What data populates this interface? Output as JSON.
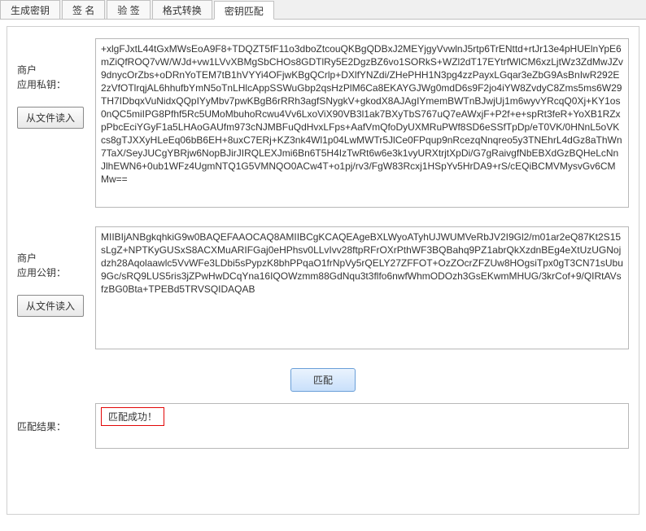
{
  "tabs": {
    "gen_key": "生成密钥",
    "sign": "签  名",
    "verify": "验  签",
    "format": "格式转换",
    "match": "密钥匹配"
  },
  "private_section": {
    "label1": "商户",
    "label2": "应用私钥：",
    "load_btn": "从文件读入",
    "value": "+xlgFJxtL44tGxMWsEoA9F8+TDQZT5fF11o3dboZtcouQKBgQDBxJ2MEYjgyVvwlnJ5rtp6TrENttd+rtJr13e4pHUElnYpE6mZiQfROQ7vW/WJd+vw1LVvXBMgSbCHOs8GDTlRy5E2DgzBZ6vo1SORkS+WZl2dT17EYtrfWlCM6xzLjtWz3ZdMwJZv9dnycOrZbs+oDRnYoTEM7tB1hVYYi4OFjwKBgQCrlp+DXlfYNZdi/ZHePHH1N3pg4zzPayxLGqar3eZbG9AsBnIwR292E2zVfOTlrqjAL6hhufbYmN5oTnLHlcAppSSWuGbp2qsHzPlM6Ca8EKAYGJWg0mdD6s9F2jo4iYW8ZvdyC8Zms5ms6W29TH7IDbqxVuNidxQQpIYyMbv7pwKBgB6rRRh3agfSNygkV+gkodX8AJAgIYmemBWTnBJwjUj1m6wyvYRcqQ0Xj+KY1os0nQC5miIPG8Pfhf5Rc5UMoMbuhoRcwu4Vv6LxoViX90VB3l1ak7BXyTbS767uQ7eAWxjF+P2f+e+spRt3feR+YoXB1RZxpPbcEciYGyF1a5LHAoGAUfm973cNJMBFuQdHvxLFps+AafVmQfoDyUXMRuPWf8SD6eSSfTpDp/eT0VK/0HNnL5oVKcs8gTJXXyHLeEq06bB6EH+8uxC7ERj+KZ3nk4Wl1p04LwMWTr5JlCe0FPqup9nRcezqNnqreo5y3TNEhrL4dGz8aThWn7TaX/SeyJUCgYBRjw6NopBJirJIRQLEXJmi6Bn6T5H4IzTwRt6w6e3k1vyURXtrjtXpDi/G7gRaivgfNbEBXdGzBQHeLcNnJlhEWN6+0ub1WFz4UgmNTQ1G5VMNQO0ACw4T+o1pj/rv3/FgW83Rcxj1HSpYv5HrDA9+rS/cEQiBCMVMysvGv6CMMw=="
  },
  "public_section": {
    "label1": "商户",
    "label2": "应用公钥：",
    "load_btn": "从文件读入",
    "value": "MIIBIjANBgkqhkiG9w0BAQEFAAOCAQ8AMIIBCgKCAQEAgeBXLWyoATyhUJWUMVeRbJV2I9Gl2/m01ar2eQ87Kt2S15sLgZ+NPTKyGUSxS8ACXMuARIFGaj0eHPhsv0LLvIvv28ftpRFrOXrPthWF3BQBahq9PZ1abrQkXzdnBEg4eXtUzUGNojdzh28Aqolaawlc5VvWFe3LDbi5sPypzK8bhPPqaO1frNpVy5rQELY27ZFFOT+OzZOcrZFZUw8HOgsiTpx0gT3CN71sUbu9Gc/sRQ9LUS5ris3jZPwHwDCqYna16IQOWzmm88GdNqu3t3flfo6nwfWhmODOzh3GsEKwmMHUG/3krCof+9/QIRtAVsfzBG0Bta+TPEBd5TRVSQIDAQAB"
  },
  "match_button": "匹配",
  "result": {
    "label": "匹配结果：",
    "text": "匹配成功！"
  }
}
